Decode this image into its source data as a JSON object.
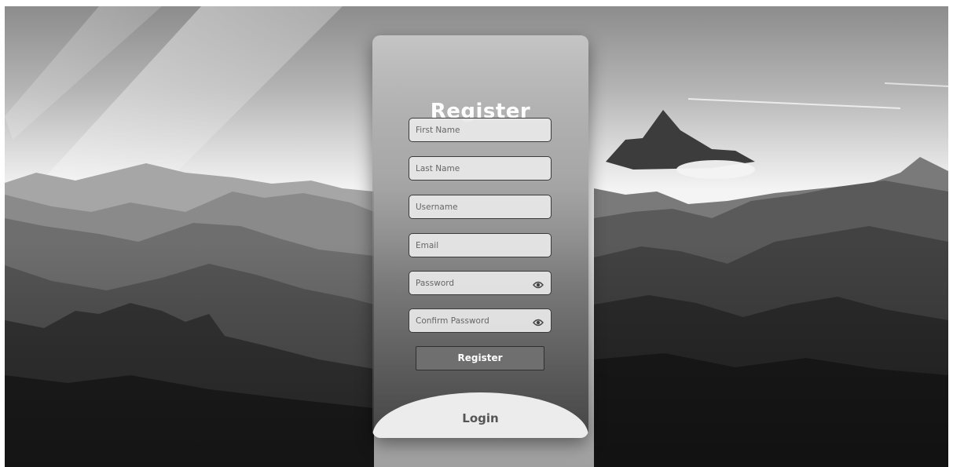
{
  "form": {
    "title": "Register",
    "fields": [
      {
        "placeholder": "First Name",
        "type": "text"
      },
      {
        "placeholder": "Last Name",
        "type": "text"
      },
      {
        "placeholder": "Username",
        "type": "text"
      },
      {
        "placeholder": "Email",
        "type": "email"
      },
      {
        "placeholder": "Password",
        "type": "password",
        "icon": "eye-icon"
      },
      {
        "placeholder": "Confirm Password",
        "type": "password",
        "icon": "eye-icon"
      }
    ],
    "submit_label": "Register",
    "login_label": "Login"
  },
  "background": {
    "description_icon": "mountain-landscape"
  }
}
